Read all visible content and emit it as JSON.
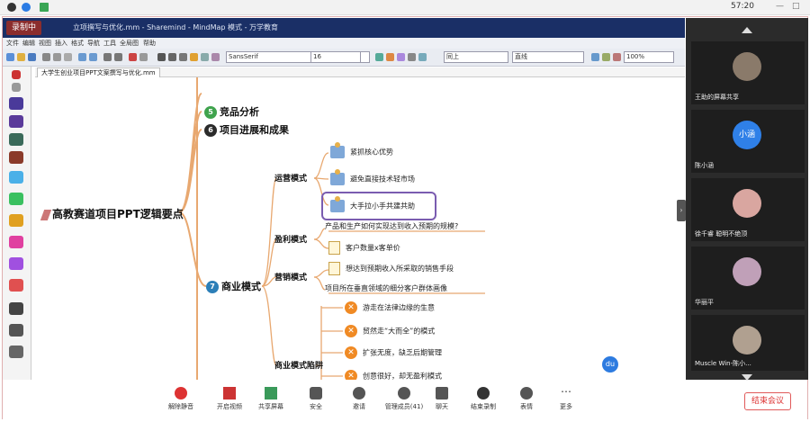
{
  "status_bar": {
    "time": "57:20"
  },
  "mindmap_window": {
    "recording_label": "录制中",
    "title": "立项撰写与优化.mm - Sharemind - MindMap 模式 - 万学教育",
    "menu": [
      "文件",
      "编辑",
      "视图",
      "插入",
      "格式",
      "导航",
      "工具",
      "全局图",
      "帮助"
    ],
    "font_family_value": "SansSerif",
    "font_size_value": "16",
    "edge_style_value": "同上",
    "line_style_value": "直线",
    "zoom_value": "100%",
    "tab_label": "大学生创业项目PPT文案撰写与优化.mm"
  },
  "mindmap": {
    "root": "高教赛道项目PPT逻辑要点",
    "branches": [
      {
        "number": "5",
        "label": "竞品分析",
        "color": "#3fa34d"
      },
      {
        "number": "6",
        "label": "项目进展和成果",
        "color": "#2b2b2b"
      },
      {
        "number": "7",
        "label": "商业模式",
        "color": "#2c7fb8"
      }
    ],
    "sub": {
      "ops": {
        "label": "运营模式",
        "items": [
          "紧抓核心优势",
          "避免直接技术轻市场",
          "大手拉小手共建共助"
        ]
      },
      "profit": {
        "label": "盈利模式",
        "note": "产品和生产如何实现达到收入预期的规模?",
        "items": [
          "客户数量x客单价"
        ]
      },
      "marketing": {
        "label": "营销模式",
        "items": [
          "想达到预期收入所采取的销售手段"
        ],
        "note": "项目所在垂直领域的细分客户群体画像"
      },
      "traps": {
        "label": "商业模式陷阱",
        "items": [
          "游走在法律边缘的生意",
          "贸然走“大而全”的模式",
          "扩张无度，缺乏后期管理",
          "创意很好，却无盈利模式"
        ]
      }
    },
    "float_icon": "du"
  },
  "participants": [
    {
      "name": "王助的屏幕共享",
      "avatar_color": "#8a7a6a"
    },
    {
      "name": "陈小涵",
      "avatar_text": "小涵",
      "avatar_color": "#2f80e8"
    },
    {
      "name": "徐千睿 聪明不绝顶",
      "avatar_color": "#d9a6a0"
    },
    {
      "name": "华丽平",
      "avatar_color": "#c0a0b8"
    },
    {
      "name": "Muscle Win-陈小...",
      "avatar_color": "#b0a090"
    }
  ],
  "toolbar": {
    "buttons": [
      {
        "label": "解除静音",
        "icon": "mic-muted-icon"
      },
      {
        "label": "开启视频",
        "icon": "camera-off-icon"
      },
      {
        "label": "共享屏幕",
        "icon": "share-screen-icon"
      },
      {
        "label": "安全",
        "icon": "shield-icon"
      },
      {
        "label": "邀请",
        "icon": "invite-icon"
      },
      {
        "label": "管理成员(41)",
        "icon": "members-icon"
      },
      {
        "label": "聊天",
        "icon": "chat-icon"
      },
      {
        "label": "结束录制",
        "icon": "stop-record-icon"
      },
      {
        "label": "表情",
        "icon": "emoji-icon"
      },
      {
        "label": "更多",
        "icon": "more-icon"
      }
    ],
    "end_meeting": "结束会议"
  }
}
